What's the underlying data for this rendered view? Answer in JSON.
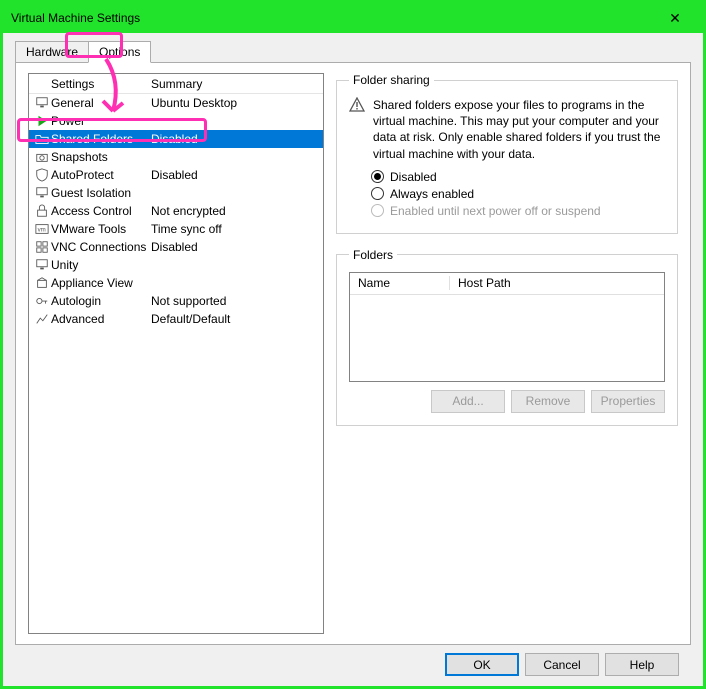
{
  "window": {
    "title": "Virtual Machine Settings"
  },
  "tabs": {
    "hardware": "Hardware",
    "options": "Options",
    "active": "Options"
  },
  "list": {
    "head_settings": "Settings",
    "head_summary": "Summary",
    "rows": [
      {
        "icon": "monitor",
        "name": "General",
        "summary": "Ubuntu Desktop"
      },
      {
        "icon": "play",
        "name": "Power",
        "summary": ""
      },
      {
        "icon": "folder",
        "name": "Shared Folders",
        "summary": "Disabled",
        "selected": true
      },
      {
        "icon": "camera",
        "name": "Snapshots",
        "summary": ""
      },
      {
        "icon": "shield",
        "name": "AutoProtect",
        "summary": "Disabled"
      },
      {
        "icon": "monitor",
        "name": "Guest Isolation",
        "summary": ""
      },
      {
        "icon": "lock",
        "name": "Access Control",
        "summary": "Not encrypted"
      },
      {
        "icon": "vm",
        "name": "VMware Tools",
        "summary": "Time sync off"
      },
      {
        "icon": "grid",
        "name": "VNC Connections",
        "summary": "Disabled"
      },
      {
        "icon": "monitor",
        "name": "Unity",
        "summary": ""
      },
      {
        "icon": "box",
        "name": "Appliance View",
        "summary": ""
      },
      {
        "icon": "key",
        "name": "Autologin",
        "summary": "Not supported"
      },
      {
        "icon": "chart",
        "name": "Advanced",
        "summary": "Default/Default"
      }
    ]
  },
  "sharing": {
    "legend": "Folder sharing",
    "warning": "Shared folders expose your files to programs in the virtual machine. This may put your computer and your data at risk. Only enable shared folders if you trust the virtual machine with your data.",
    "opt_disabled": "Disabled",
    "opt_always": "Always enabled",
    "opt_until": "Enabled until next power off or suspend",
    "selected": "Disabled"
  },
  "folders": {
    "legend": "Folders",
    "col_name": "Name",
    "col_host": "Host Path",
    "btn_add": "Add...",
    "btn_remove": "Remove",
    "btn_props": "Properties"
  },
  "footer": {
    "ok": "OK",
    "cancel": "Cancel",
    "help": "Help"
  }
}
